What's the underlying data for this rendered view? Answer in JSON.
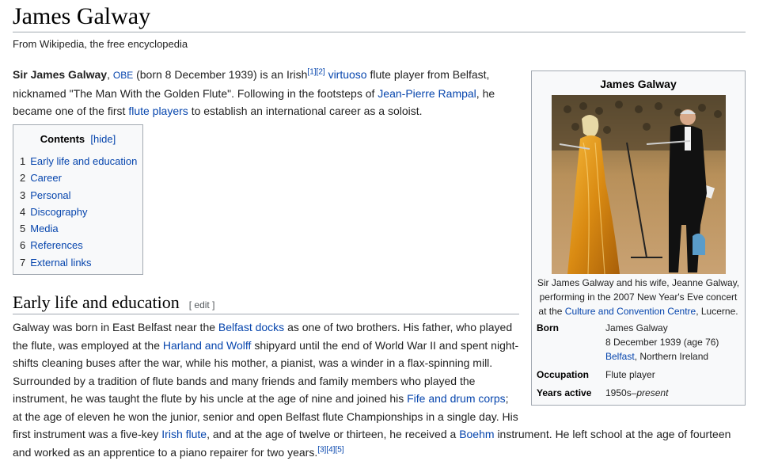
{
  "header": {
    "title": "James Galway",
    "tagline": "From Wikipedia, the free encyclopedia"
  },
  "intro": {
    "bold_name": "Sir James Galway",
    "obe": "OBE",
    "t1": "(born 8 December 1939) is an Irish",
    "ref1": "[1]",
    "ref2": "[2]",
    "virtuoso": "virtuoso",
    "t2": "flute player from Belfast, nicknamed \"The Man With the Golden Flute\". Following in the footsteps of",
    "rampal": "Jean-Pierre Rampal",
    "t3": ", he became one of the first",
    "flute_players": "flute players",
    "t4": "to establish an international career as a soloist."
  },
  "toc": {
    "title": "Contents",
    "hide": "[hide]",
    "items": [
      {
        "num": "1",
        "label": "Early life and education"
      },
      {
        "num": "2",
        "label": "Career"
      },
      {
        "num": "3",
        "label": "Personal"
      },
      {
        "num": "4",
        "label": "Discography"
      },
      {
        "num": "5",
        "label": "Media"
      },
      {
        "num": "6",
        "label": "References"
      },
      {
        "num": "7",
        "label": "External links"
      }
    ]
  },
  "section1": {
    "heading": "Early life and education",
    "edit": "[ edit ]",
    "s1": "Galway was born in East Belfast near the",
    "belfast_docks": "Belfast docks",
    "s2": "as one of two brothers. His father, who played the flute, was employed at the",
    "harland": "Harland and Wolff",
    "s3": "shipyard until the end of World War II and spent night-shifts cleaning buses after the war, while his mother, a pianist, was a winder in a flax-spinning mill. Surrounded by a tradition of flute bands and many friends and family members who played the instrument, he was taught the flute by his uncle at the age of nine and joined his",
    "fife": "Fife and drum corps",
    "s4": "; at the age of eleven he won the junior, senior and open Belfast flute Championships in a single day. His",
    "s5": "first instrument was a five-key",
    "irish_flute": "Irish flute",
    "s6": ", and at the age of twelve or thirteen, he received a",
    "boehm": "Boehm",
    "s7": "instrument. He left school at the age of fourteen and worked as an apprentice to a piano repairer for two years.",
    "ref3": "[3]",
    "ref4": "[4]",
    "ref5": "[5]"
  },
  "infobox": {
    "title": "James Galway",
    "caption1": "Sir James Galway and his wife, Jeanne Galway, performing in the 2007 New Year's Eve concert at the",
    "caption_link": "Culture and Convention Centre",
    "caption2": ", Lucerne.",
    "born_label": "Born",
    "born_name": "James Galway",
    "born_date": "8 December 1939 (age 76)",
    "born_place_link": "Belfast",
    "born_place_rest": ", Northern Ireland",
    "occupation_label": "Occupation",
    "occupation_value": "Flute player",
    "years_label": "Years active",
    "years_value_start": "1950s–",
    "years_value_italic": "present"
  }
}
